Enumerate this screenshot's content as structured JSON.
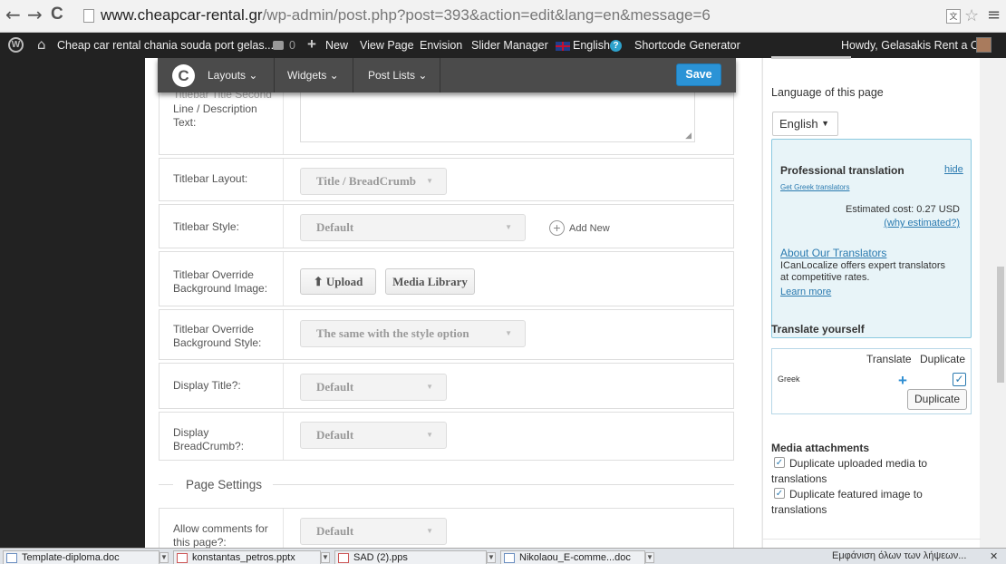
{
  "browser": {
    "back_glyph": "←",
    "forward_glyph": "→",
    "reload_glyph": "C",
    "url_host": "www.cheapcar-rental.gr",
    "url_path": "/wp-admin/post.php?post=393&action=edit&lang=en&message=6",
    "star_glyph": "☆",
    "menu_glyph": "≡"
  },
  "admin_bar": {
    "site_name": "Cheap car rental chania souda port gelas...",
    "comments_count": "0",
    "new_label": "New",
    "view_page_label": "View Page",
    "envision_label": "Envision",
    "slider_manager_label": "Slider Manager",
    "language_label": "English",
    "shortcode_label": "Shortcode Generator",
    "greeting": "Howdy, Gelasakis Rent a Car"
  },
  "toolbar": {
    "logo": "C",
    "layouts_label": "Layouts ⌄",
    "widgets_label": "Widgets ⌄",
    "post_lists_label": "Post Lists ⌄",
    "save_label": "Save"
  },
  "form": {
    "cut_label": "Titlebar Title Second",
    "desc_label_1": "Line / Description",
    "desc_label_2": "Text:",
    "titlebar_layout": {
      "label": "Titlebar Layout:",
      "value": "Title / BreadCrumb"
    },
    "titlebar_style": {
      "label": "Titlebar Style:",
      "value": "Default",
      "add_new": "Add New"
    },
    "override_bg_image": {
      "label_1": "Titlebar Override",
      "label_2": "Background Image:",
      "upload": "Upload",
      "media_library": "Media Library"
    },
    "override_bg_style": {
      "label_1": "Titlebar Override",
      "label_2": "Background Style:",
      "value": "The same with the style option"
    },
    "display_title": {
      "label": "Display Title?:",
      "value": "Default"
    },
    "display_breadcrumb": {
      "label_1": "Display",
      "label_2": "BreadCrumb?:",
      "value": "Default"
    },
    "page_settings_title": "Page Settings",
    "allow_comments": {
      "label_1": "Allow comments for",
      "label_2": "this page?:",
      "value": "Default"
    }
  },
  "sidebar_right": {
    "language_heading": "Language of this page",
    "language_value": "English",
    "pro_title": "Professional translation",
    "hide_link": "hide",
    "get_translators": "Get Greek translators",
    "estimated_cost": "Estimated cost: 0.27 USD",
    "why_estimated": "(why estimated?)",
    "about_translators": "About Our Translators",
    "about_text_1": "ICanLocalize offers expert translators",
    "about_text_2": "at competitive rates.",
    "learn_more": "Learn more",
    "translate_yourself": "Translate yourself",
    "col_translate": "Translate",
    "col_duplicate": "Duplicate",
    "row_language": "Greek",
    "duplicate_button": "Duplicate",
    "media_heading": "Media attachments",
    "dup_uploaded_1": "Duplicate uploaded media to",
    "dup_uploaded_2": "translations",
    "dup_featured_1": "Duplicate featured image to",
    "dup_featured_2": "translations"
  },
  "taskbar": {
    "items": [
      "Template-diploma.doc",
      "konstantas_petros.pptx",
      "SAD (2).pps",
      "Nikolaou_E-comme...doc"
    ],
    "status": "Εμφάνιση όλων των λήψεων...",
    "close": "✕"
  }
}
